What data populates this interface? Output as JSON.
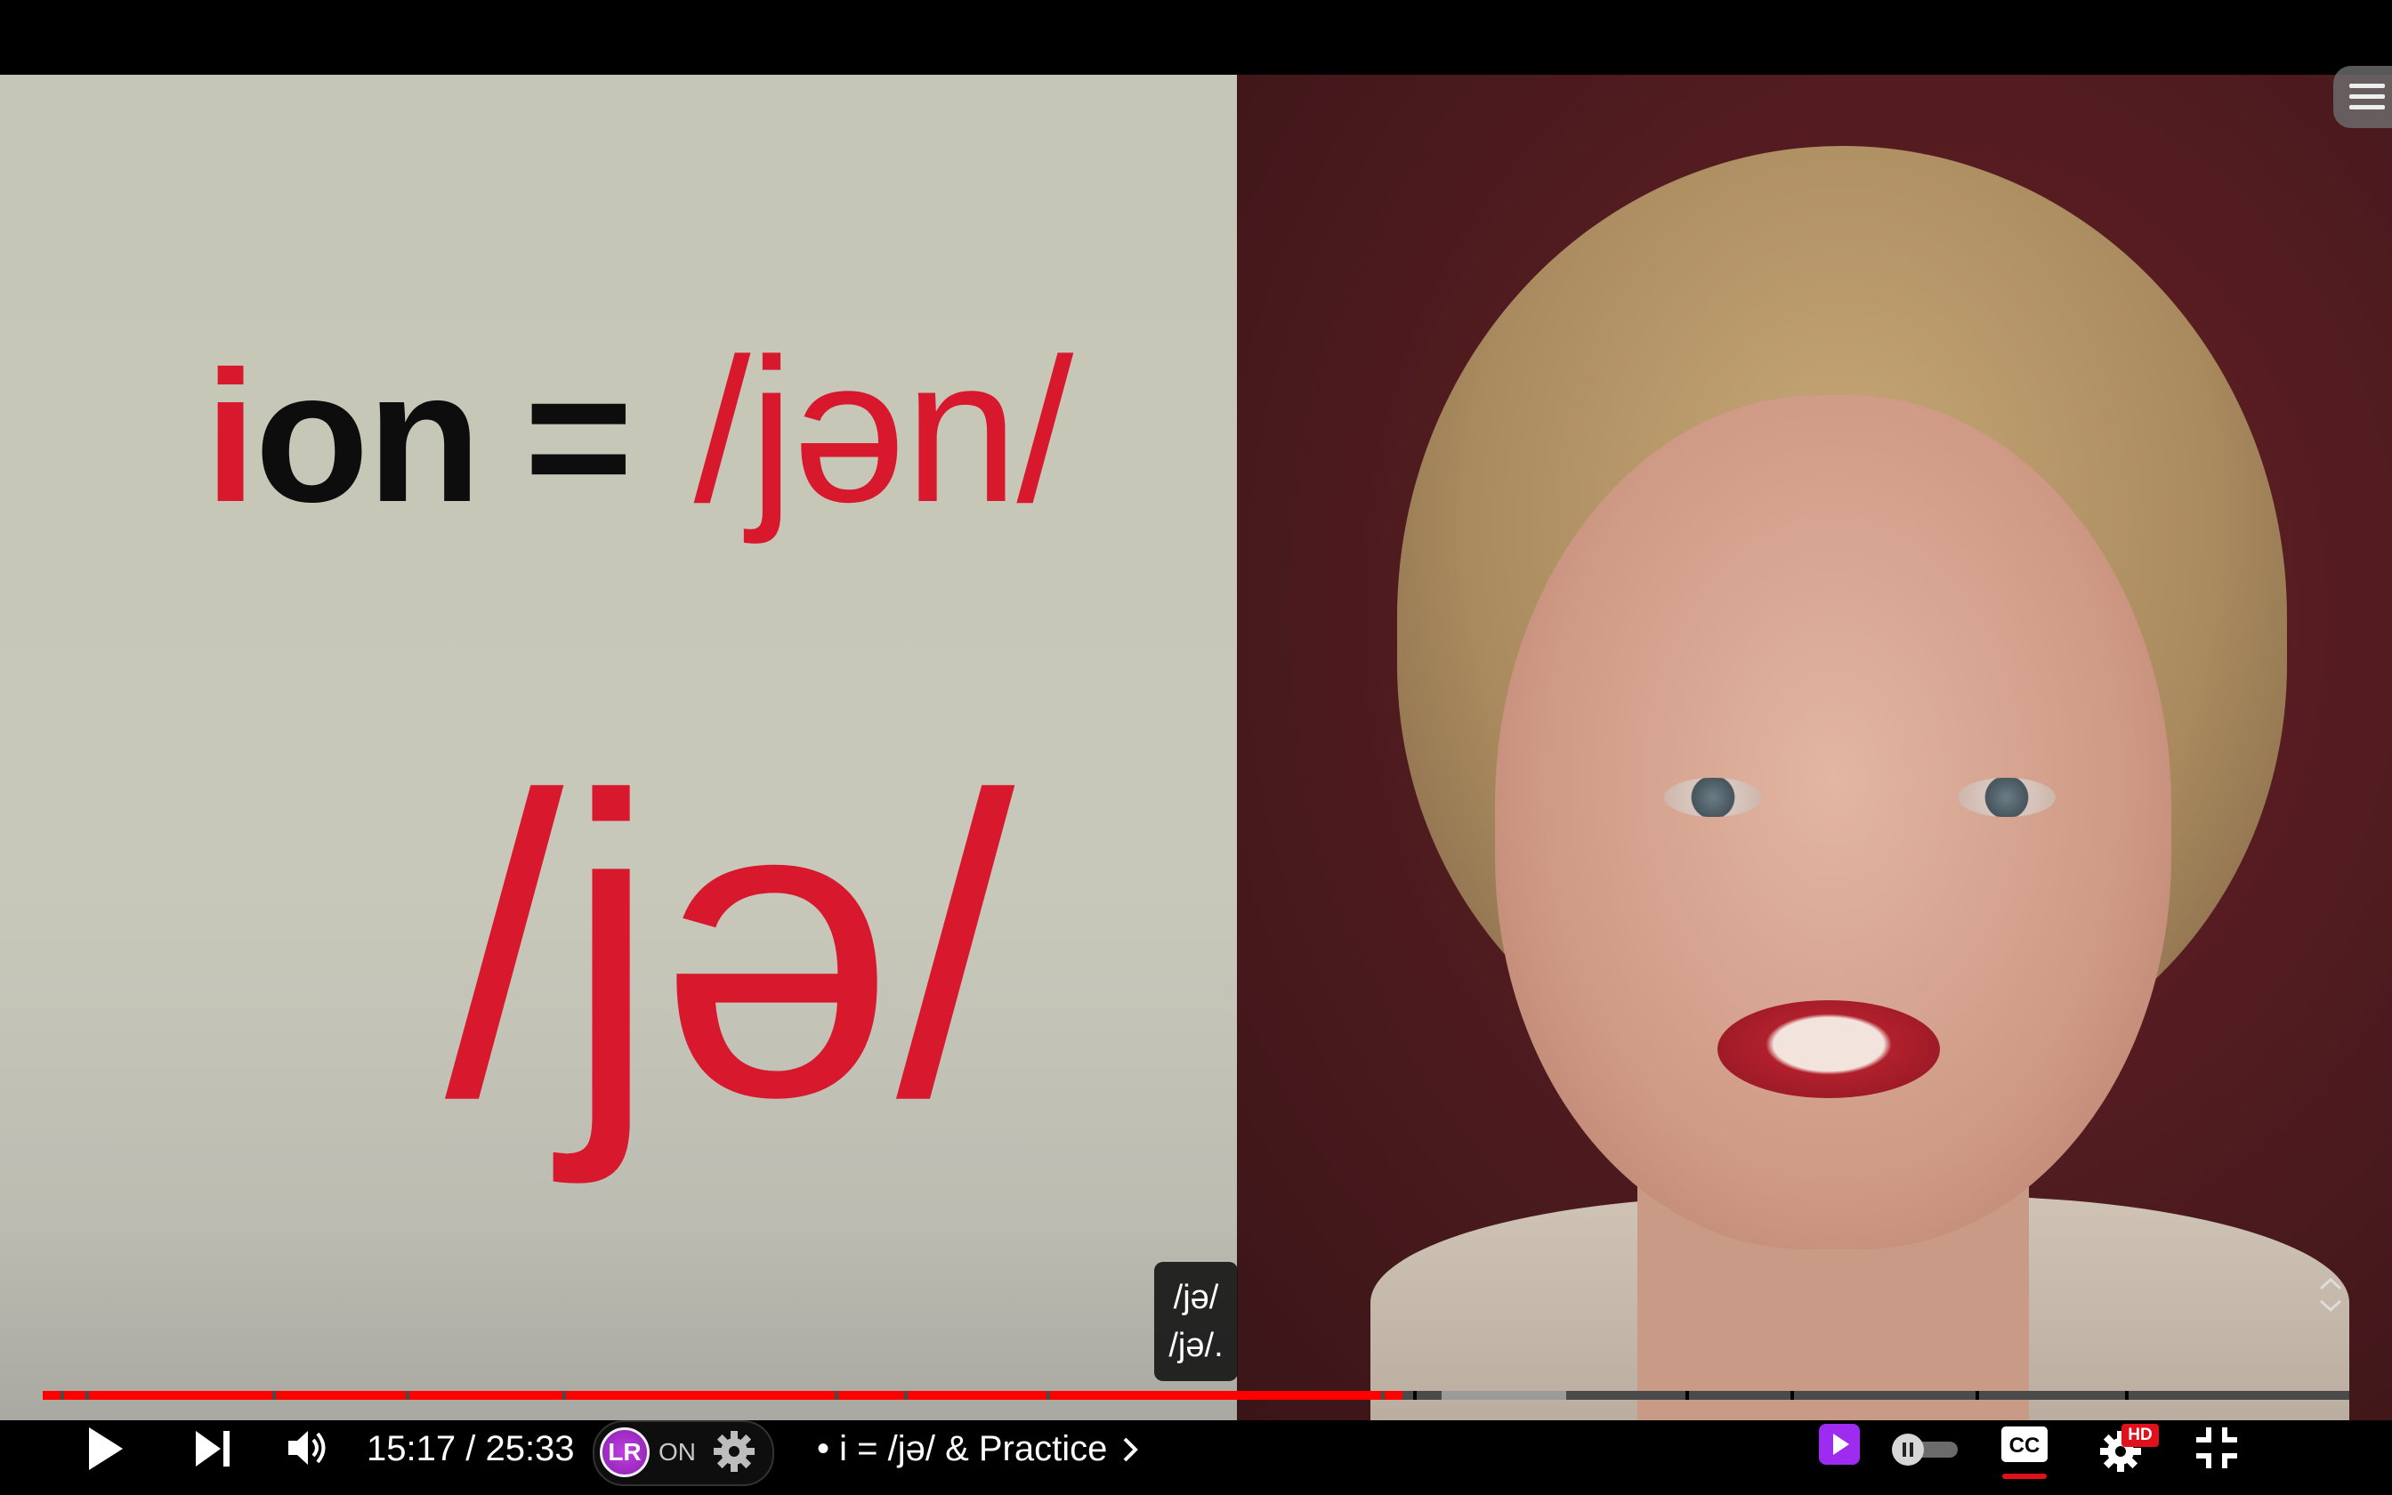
{
  "slide": {
    "word_first_letter": "i",
    "word_rest": "on",
    "equals": "=",
    "word_ipa": "/jən/",
    "big_ipa": "/jə/"
  },
  "caption": {
    "line1": "/jə/",
    "line2": "/jə/."
  },
  "player": {
    "time_current": "15:17",
    "time_separator": " / ",
    "time_total": "25:33",
    "lr_extension_label": "LR",
    "lr_extension_state": "ON",
    "chapter_bullet": "•",
    "chapter_title": "i = /jə/ & Practice",
    "hd_badge": "HD",
    "progress_fraction": 0.598
  },
  "colors": {
    "accent_red": "#d7182d",
    "progress_red": "#ff0000",
    "progress_buffer": "#9a9a9a",
    "progress_track": "#4a4a4a"
  },
  "icons": {
    "play": "play-icon",
    "next": "skip-next-icon",
    "volume": "volume-icon",
    "settings": "gear-icon",
    "autoplay": "autoplay-toggle-icon",
    "subtitles": "cc-icon",
    "exit_fullscreen": "exit-fullscreen-icon",
    "menu": "menu-icon"
  }
}
